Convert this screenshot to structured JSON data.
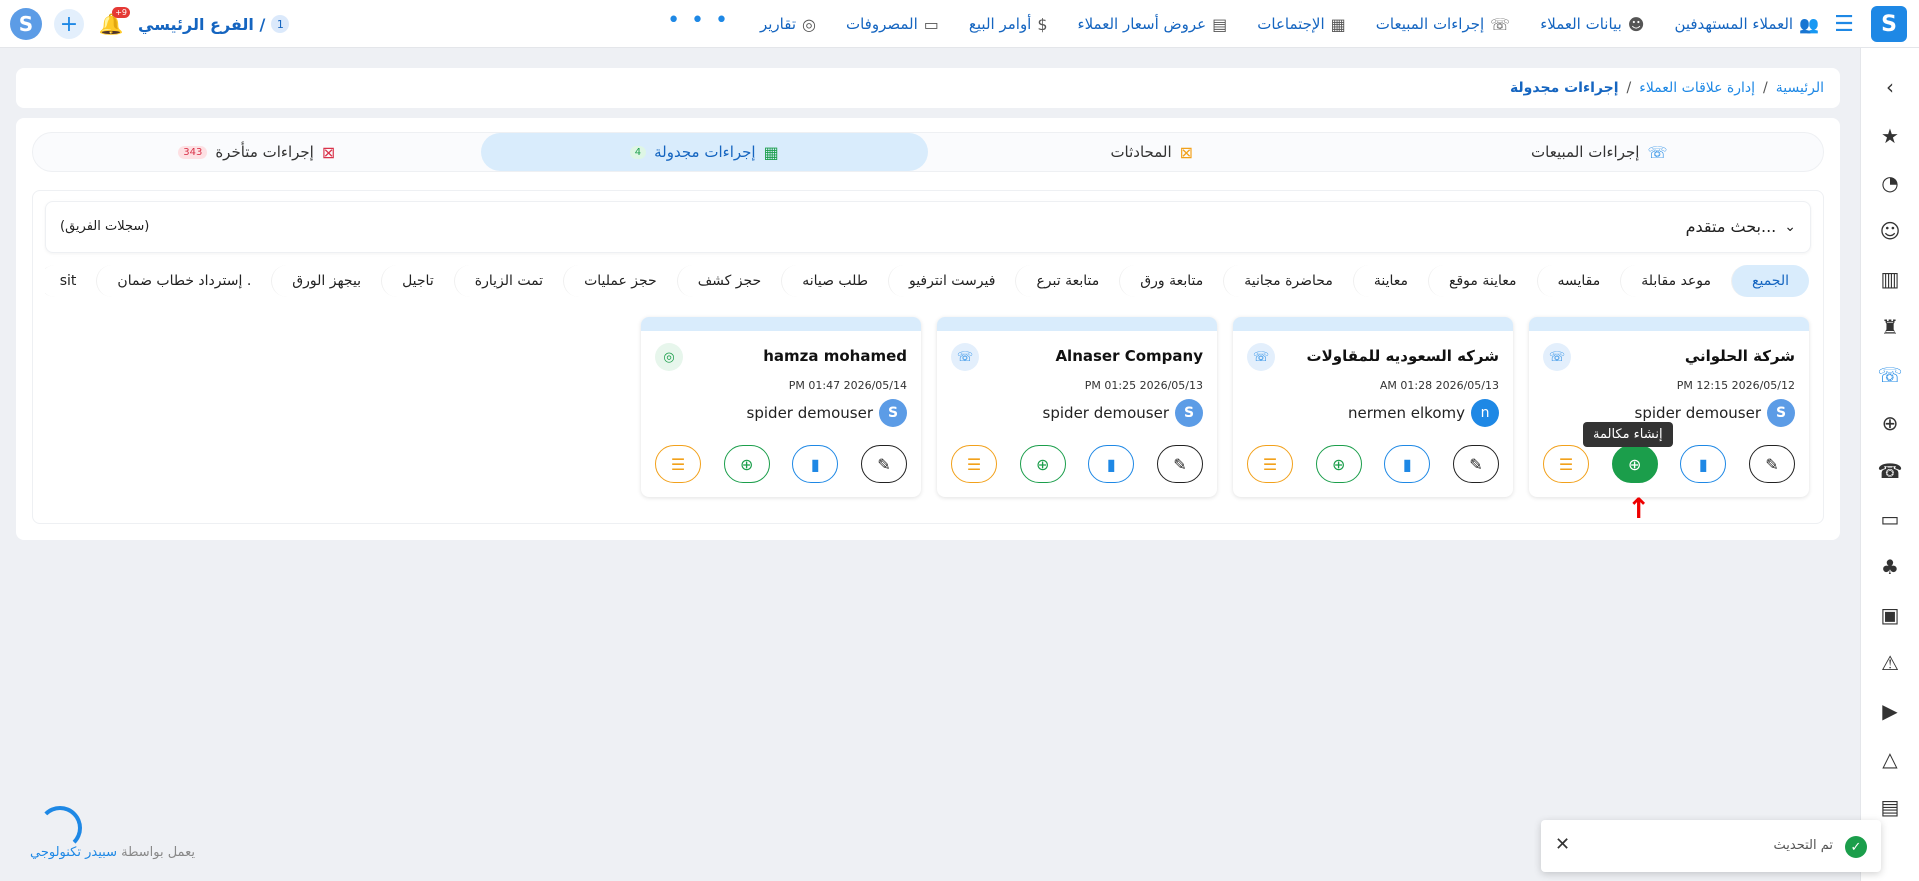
{
  "topbar": {
    "nav": [
      {
        "label": "العملاء المستهدفين",
        "icon": "target-users-icon",
        "glyph": "👥"
      },
      {
        "label": "بيانات العملاء",
        "icon": "customer-data-icon",
        "glyph": "☻"
      },
      {
        "label": "إجراءات المبيعات",
        "icon": "phone-icon",
        "glyph": "☏"
      },
      {
        "label": "الإجتماعات",
        "icon": "presentation-icon",
        "glyph": "▦"
      },
      {
        "label": "عروض أسعار العملاء",
        "icon": "quote-icon",
        "glyph": "▤"
      },
      {
        "label": "أوامر البيع",
        "icon": "money-bag-icon",
        "glyph": "$"
      },
      {
        "label": "المصروفات",
        "icon": "laptop-icon",
        "glyph": "▭"
      },
      {
        "label": "تقارير",
        "icon": "report-icon",
        "glyph": "◎"
      }
    ],
    "more": "• • •",
    "branch_label": "الفرع الرئيسي /",
    "branch_num": "1",
    "bell_badge": "+9"
  },
  "breadcrumb": {
    "home": "الرئيسية",
    "crm": "إدارة علاقات العملاء",
    "current": "إجراءات مجدولة",
    "sep": "/"
  },
  "tabs": [
    {
      "label": "إجراءات المبيعات",
      "icon": "phone-icon",
      "glyph": "☏",
      "count": null,
      "active": false
    },
    {
      "label": "المحادثات",
      "icon": "chat-off-icon",
      "glyph": "⊠",
      "count": null,
      "active": false
    },
    {
      "label": "إجراءات مجدولة",
      "icon": "calendar-icon",
      "glyph": "▦",
      "count": "4",
      "active": true
    },
    {
      "label": "إجراءات متأخرة",
      "icon": "calendar-x-icon",
      "glyph": "⊠",
      "count": "343",
      "active": false
    }
  ],
  "filter": {
    "advanced_search": "بحث متقدم...",
    "team_records": "(سجلات الفريق)"
  },
  "chips": [
    "الجميع",
    "موعد مقابلة",
    "مقايسه",
    "معاينة موقع",
    "معاينة",
    "محاضرة مجانية",
    "متابعة ورق",
    "متابعة تبرع",
    "فيرست انترفيو",
    "طلب صيانه",
    "حجز كشف",
    "حجز عمليات",
    "تمت الزيارة",
    "تاجيل",
    "بيجهز الورق",
    "إسترداد خطاب ضمان .",
    "sit"
  ],
  "cards": [
    {
      "name": "شركة الحلواني",
      "date": "2026/05/12 12:15 PM",
      "user": "spider demouser",
      "avatar": "logo",
      "corner": "phone"
    },
    {
      "name": "شركه السعوديه للمقاولات",
      "date": "2026/05/13 01:28 AM",
      "user": "nermen elkomy",
      "avatar": "n",
      "corner": "phone"
    },
    {
      "name": "Alnaser Company",
      "date": "2026/05/13 01:25 PM",
      "user": "spider demouser",
      "avatar": "logo",
      "corner": "phone"
    },
    {
      "name": "hamza mohamed",
      "date": "2026/05/14 01:47 PM",
      "user": "spider demouser",
      "avatar": "logo",
      "corner": "pin"
    }
  ],
  "tooltip": "إنشاء مكالمة",
  "toast": {
    "message": "تم التحديث"
  },
  "footer": {
    "prefix": "يعمل بواسطة",
    "brand": "سبيدر تكنولوجي"
  },
  "colors": {
    "primary": "#1e88e5",
    "green": "#1b9e4b",
    "orange": "#f2a11b",
    "red": "#e53935"
  }
}
